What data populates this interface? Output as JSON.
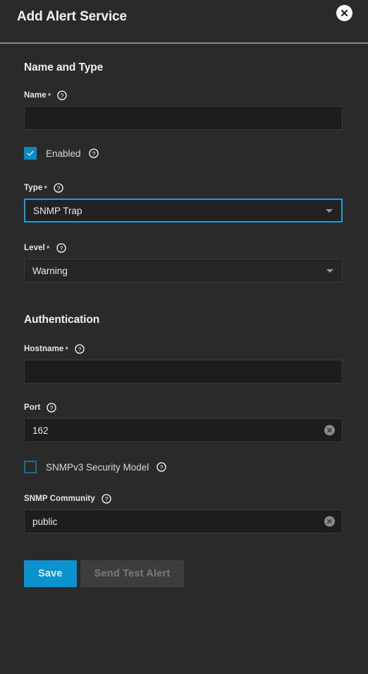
{
  "dialog": {
    "title": "Add Alert Service",
    "close_icon": "close-icon"
  },
  "sections": [
    {
      "title": "Name and Type"
    },
    {
      "title": "Authentication"
    }
  ],
  "fields": {
    "name": {
      "label": "Name",
      "required_marker": "*",
      "value": "",
      "placeholder": "",
      "help_icon": "help-icon"
    },
    "enabled": {
      "label": "Enabled",
      "checked": true,
      "help_icon": "help-icon"
    },
    "type": {
      "label": "Type",
      "required_marker": "*",
      "value": "SNMP Trap",
      "focused": true,
      "caret_icon": "chevron-down-icon",
      "help_icon": "help-icon"
    },
    "level": {
      "label": "Level",
      "required_marker": "*",
      "value": "Warning",
      "focused": false,
      "caret_icon": "chevron-down-icon",
      "help_icon": "help-icon"
    },
    "hostname": {
      "label": "Hostname",
      "required_marker": "*",
      "value": "",
      "placeholder": "",
      "help_icon": "help-icon"
    },
    "port": {
      "label": "Port",
      "required_marker": "",
      "value": "162",
      "clear_icon": "clear-icon",
      "help_icon": "help-icon"
    },
    "snmpv3": {
      "label": "SNMPv3 Security Model",
      "checked": false,
      "help_icon": "help-icon"
    },
    "community": {
      "label": "SNMP Community",
      "required_marker": "",
      "value": "public",
      "clear_icon": "clear-icon",
      "help_icon": "help-icon"
    }
  },
  "buttons": {
    "save": "Save",
    "send_test": "Send Test Alert"
  },
  "colors": {
    "accent": "#0a93cf",
    "checkbox_checked": "#0a8bc4",
    "focus_border": "#1a9fd9",
    "background": "#2a2a2a",
    "input_background": "#1d1d1d"
  }
}
